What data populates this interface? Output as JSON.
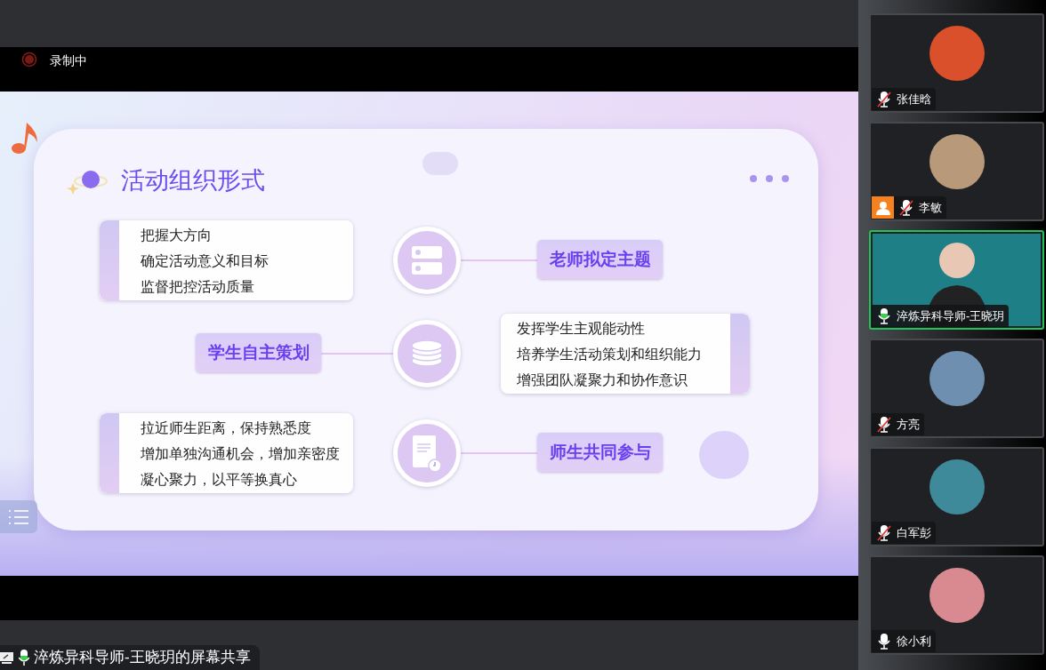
{
  "recording": {
    "label": "录制中"
  },
  "slide": {
    "title": "活动组织形式",
    "rows": [
      {
        "label": "老师拟定主题",
        "bullets": [
          "把握大方向",
          "确定活动意义和目标",
          "监督把控活动质量"
        ]
      },
      {
        "label": "学生自主策划",
        "bullets": [
          "发挥学生主观能动性",
          "培养学生活动策划和组织能力",
          "增强团队凝聚力和协作意识"
        ]
      },
      {
        "label": "师生共同参与",
        "bullets": [
          "拉近师生距离，保持熟悉度",
          "增加单独沟通机会，增加亲密度",
          "凝心聚力，以平等换真心"
        ]
      }
    ]
  },
  "share_label": {
    "text": "淬炼异科导师-王晓玥的屏幕共享",
    "mic_on": true
  },
  "participants": [
    {
      "name": "张佳晗",
      "kind": "avatar",
      "muted": true,
      "host": false,
      "selected": false,
      "color": "#d9502a"
    },
    {
      "name": "李敏",
      "kind": "avatar",
      "muted": true,
      "host": true,
      "selected": false,
      "color": "#b89a7a"
    },
    {
      "name": "淬炼异科导师-王晓玥",
      "kind": "video",
      "muted": false,
      "host": false,
      "selected": true,
      "color": "#1f7f86"
    },
    {
      "name": "方亮",
      "kind": "avatar",
      "muted": true,
      "host": false,
      "selected": false,
      "color": "#6f8fb0"
    },
    {
      "name": "白军彭",
      "kind": "avatar",
      "muted": true,
      "host": false,
      "selected": false,
      "color": "#3f8a9a"
    },
    {
      "name": "徐小利",
      "kind": "avatar",
      "muted": false,
      "host": false,
      "selected": false,
      "color": "#d98a90"
    }
  ]
}
